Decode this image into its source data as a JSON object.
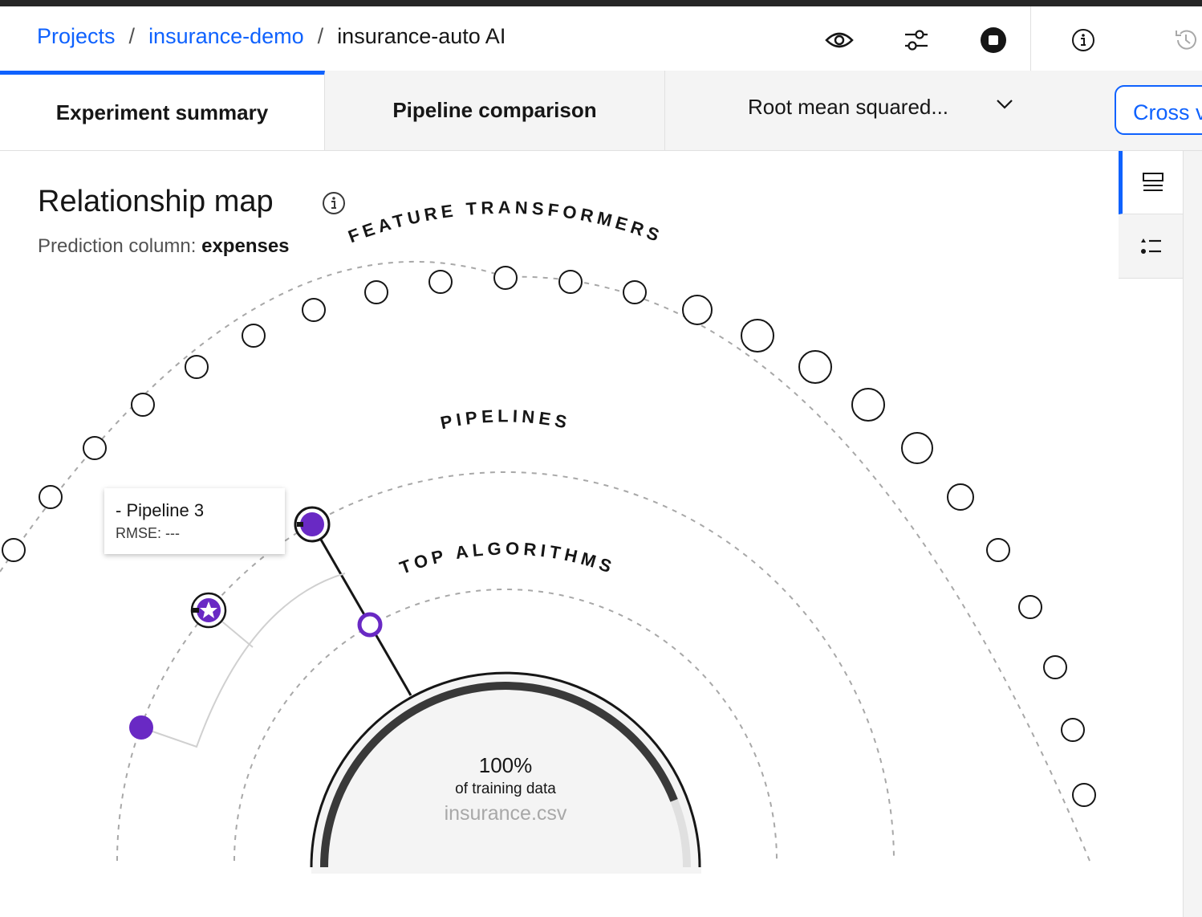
{
  "header": {
    "breadcrumbs": [
      {
        "label": "Projects"
      },
      {
        "label": "insurance-demo"
      },
      {
        "label": "insurance-auto AI"
      }
    ],
    "separator": "/",
    "icons": [
      "view-icon",
      "settings-sliders-icon",
      "stop-icon",
      "information-icon",
      "history-icon"
    ]
  },
  "tabs": [
    {
      "label": "Experiment summary",
      "selected": true
    },
    {
      "label": "Pipeline comparison",
      "selected": false
    }
  ],
  "metric_select": {
    "value": "Root mean squared..."
  },
  "cross_validation_button": {
    "label": "Cross v"
  },
  "main": {
    "title": "Relationship map",
    "prediction_label": "Prediction column:",
    "prediction_value": "expenses"
  },
  "map": {
    "rings": {
      "feature_transformers": "FEATURE TRANSFORMERS",
      "pipelines": "PIPELINES",
      "top_algorithms": "TOP ALGORITHMS"
    },
    "center": {
      "percent": "100%",
      "caption": "of training data",
      "file": "insurance.csv",
      "progress_fraction": 0.88
    },
    "accent_color": "#6929c4",
    "tooltip": {
      "title": "- Pipeline 3",
      "metric": "RMSE: ---"
    }
  },
  "right_rail": {
    "icons": [
      "list-view-icon",
      "list-numbered-icon"
    ]
  }
}
